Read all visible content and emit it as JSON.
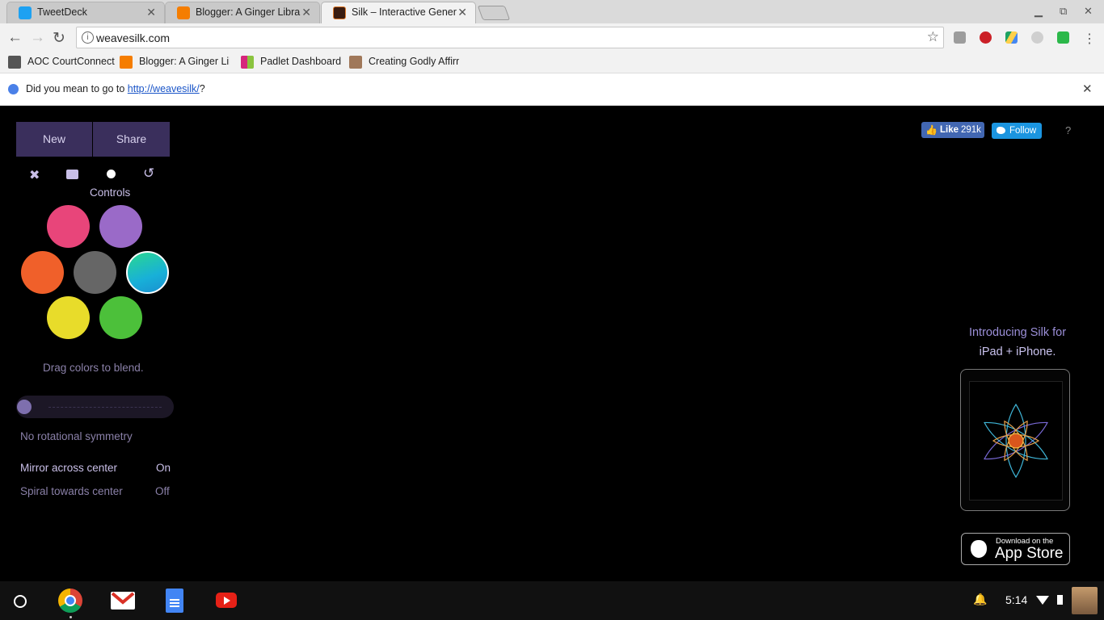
{
  "browser": {
    "tabs": [
      {
        "title": "TweetDeck",
        "icon": "twitter-icon"
      },
      {
        "title": "Blogger: A Ginger Librari",
        "icon": "blogger-icon"
      },
      {
        "title": "Silk – Interactive Generat",
        "icon": "silk-icon",
        "active": true
      }
    ],
    "close_glyph": "✕",
    "url": "weavesilk.com",
    "bookmarks": [
      {
        "label": "AOC CourtConnect"
      },
      {
        "label": "Blogger: A Ginger Lib"
      },
      {
        "label": "Padlet Dashboard"
      },
      {
        "label": "Creating Godly Affirm"
      }
    ],
    "extension_icons": [
      "evernote-icon",
      "pinterest-icon",
      "google-drive-icon",
      "extension-icon",
      "classroom-icon"
    ]
  },
  "infobar": {
    "prefix": "Did you mean to go to ",
    "link": "http://weavesilk/",
    "suffix": "?"
  },
  "silk": {
    "new_label": "New",
    "share_label": "Share",
    "controls_label": "Controls",
    "swatches": [
      {
        "name": "pink",
        "color": "#e8457a"
      },
      {
        "name": "purple",
        "color": "#9a6ac8"
      },
      {
        "name": "orange",
        "color": "#f0602a"
      },
      {
        "name": "gray",
        "color": "#666666"
      },
      {
        "name": "teal",
        "color": "#1cb8d0",
        "selected": true
      },
      {
        "name": "yellow",
        "color": "#e8dc2a"
      },
      {
        "name": "green",
        "color": "#4cc03a"
      }
    ],
    "blend_hint": "Drag colors to blend.",
    "symmetry_level": 0,
    "symmetry_label": "No rotational symmetry",
    "mirror_label": "Mirror across center",
    "mirror_value": "On",
    "spiral_label": "Spiral towards center",
    "spiral_value": "Off",
    "like_label": "Like",
    "like_count": "291k",
    "follow_label": "Follow",
    "help_label": "?",
    "promo_line1": "Introducing Silk for",
    "promo_line2": "iPad + iPhone.",
    "appstore_small": "Download on the",
    "appstore_big": "App Store"
  },
  "taskbar": {
    "apps": [
      "chrome-icon",
      "gmail-icon",
      "docs-icon",
      "youtube-icon"
    ],
    "time": "5:14"
  }
}
